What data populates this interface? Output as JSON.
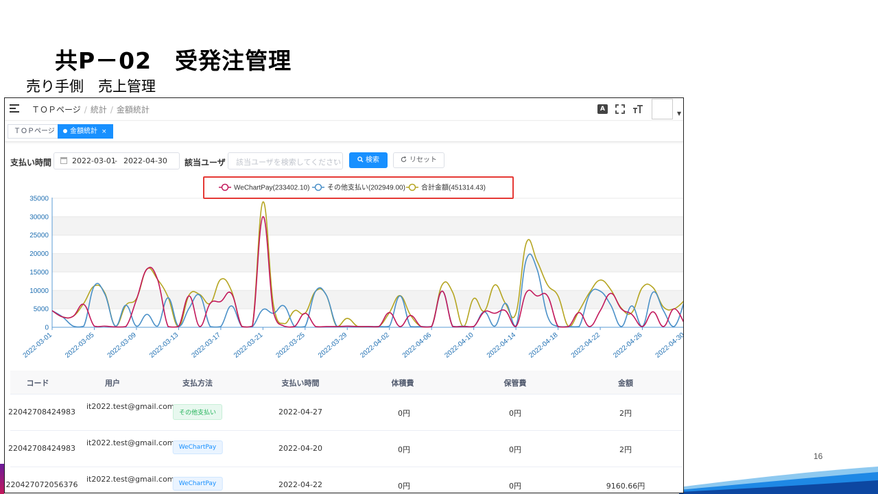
{
  "slide": {
    "title": "共P－02　受発注管理",
    "subtitle": "売り手側　売上管理",
    "page_number": "16"
  },
  "navbar": {
    "breadcrumb": [
      "ＴＯＰページ",
      "統計",
      "金額統計"
    ],
    "icons": [
      "translate-icon",
      "fullscreen-icon",
      "font-size-icon"
    ],
    "translate_glyph": "A"
  },
  "tags": [
    {
      "label": "ＴＯＰページ",
      "active": false
    },
    {
      "label": "金額統計",
      "active": true,
      "close": "×"
    }
  ],
  "filter": {
    "payment_time_label": "支払い時間",
    "date_start": "2022-03-01",
    "date_sep": "-",
    "date_end": "2022-04-30",
    "user_label": "該当ユーザ",
    "user_placeholder": "該当ユーザを検索してください",
    "search_button": "検索",
    "reset_button": "リセット"
  },
  "colors": {
    "wechat": "#c2185b",
    "other": "#4a90c8",
    "total": "#b5a521",
    "primary": "#1890ff",
    "highlight_box": "#e53935"
  },
  "chart_data": {
    "type": "line",
    "legend": [
      {
        "name": "WeChartPay(233402.10)",
        "key": "wechat"
      },
      {
        "name": "その他支払い(202949.00)",
        "key": "other"
      },
      {
        "name": "合計金額(451314.43)",
        "key": "total"
      }
    ],
    "legend_position": "top-center",
    "ylim": [
      0,
      35000
    ],
    "yticks": [
      "0",
      "5000",
      "10000",
      "15000",
      "20000",
      "25000",
      "30000",
      "35000"
    ],
    "grid": "horizontal bands",
    "x": [
      "2022-03-01",
      "2022-03-02",
      "2022-03-03",
      "2022-03-04",
      "2022-03-05",
      "2022-03-06",
      "2022-03-07",
      "2022-03-08",
      "2022-03-09",
      "2022-03-10",
      "2022-03-11",
      "2022-03-12",
      "2022-03-13",
      "2022-03-14",
      "2022-03-15",
      "2022-03-16",
      "2022-03-17",
      "2022-03-18",
      "2022-03-19",
      "2022-03-20",
      "2022-03-21",
      "2022-03-22",
      "2022-03-23",
      "2022-03-24",
      "2022-03-25",
      "2022-03-26",
      "2022-03-27",
      "2022-03-28",
      "2022-03-29",
      "2022-03-30",
      "2022-03-31",
      "2022-04-01",
      "2022-04-02",
      "2022-04-03",
      "2022-04-04",
      "2022-04-05",
      "2022-04-06",
      "2022-04-07",
      "2022-04-08",
      "2022-04-09",
      "2022-04-10",
      "2022-04-11",
      "2022-04-12",
      "2022-04-13",
      "2022-04-14",
      "2022-04-15",
      "2022-04-16",
      "2022-04-17",
      "2022-04-18",
      "2022-04-19",
      "2022-04-20",
      "2022-04-21",
      "2022-04-22",
      "2022-04-23",
      "2022-04-24",
      "2022-04-25",
      "2022-04-26",
      "2022-04-27",
      "2022-04-28",
      "2022-04-29",
      "2022-04-30"
    ],
    "xtick_labels": [
      "2022-03-01",
      "2022-03-05",
      "2022-03-09",
      "2022-03-13",
      "2022-03-17",
      "2022-03-21",
      "2022-03-25",
      "2022-03-29",
      "2022-04-02",
      "2022-04-06",
      "2022-04-10",
      "2022-04-14",
      "2022-04-18",
      "2022-04-22",
      "2022-04-26",
      "2022-04-30"
    ],
    "series": [
      {
        "key": "wechat",
        "values": [
          4500,
          2800,
          3000,
          6200,
          300,
          300,
          100,
          200,
          7500,
          15800,
          13000,
          200,
          200,
          8500,
          200,
          6500,
          7000,
          9200,
          200,
          300,
          30000,
          4000,
          300,
          200,
          3800,
          200,
          200,
          200,
          300,
          200,
          200,
          200,
          4000,
          200,
          3200,
          200,
          200,
          9800,
          200,
          200,
          200,
          4200,
          3800,
          4500,
          200,
          9500,
          8500,
          8500,
          200,
          200,
          4000,
          200,
          4500,
          9200,
          5000,
          3500,
          200,
          4200,
          200,
          5000,
          1000
        ]
      },
      {
        "key": "other",
        "values": [
          4500,
          2800,
          300,
          300,
          11200,
          9000,
          300,
          6000,
          300,
          3500,
          300,
          8000,
          300,
          5200,
          8700,
          200,
          200,
          5800,
          200,
          200,
          4800,
          3800,
          5800,
          200,
          200,
          9800,
          8800,
          300,
          300,
          200,
          200,
          200,
          300,
          8500,
          200,
          200,
          200,
          9800,
          300,
          300,
          200,
          4200,
          300,
          6500,
          300,
          18500,
          15800,
          3000,
          200,
          200,
          200,
          9000,
          9800,
          6000,
          200,
          5800,
          200,
          9500,
          4500,
          200,
          7200
        ]
      },
      {
        "key": "total",
        "values": [
          4500,
          2800,
          3000,
          6500,
          11200,
          9300,
          300,
          6000,
          7800,
          15800,
          13000,
          8200,
          200,
          8800,
          8900,
          6500,
          13000,
          10000,
          200,
          300,
          34000,
          6000,
          1000,
          4500,
          3800,
          9800,
          8800,
          200,
          2400,
          200,
          200,
          200,
          4000,
          8600,
          3300,
          200,
          200,
          11500,
          9500,
          200,
          7800,
          4400,
          11500,
          6500,
          3800,
          23000,
          18000,
          11500,
          8500,
          200,
          4500,
          9500,
          12800,
          10200,
          5200,
          4000,
          10800,
          10800,
          5500,
          5000,
          7300
        ]
      }
    ]
  },
  "table": {
    "headers": [
      "コード",
      "用户",
      "支払方法",
      "支払い時間",
      "体積費",
      "保管費",
      "金額"
    ],
    "rows": [
      {
        "code": "22042708424983",
        "user": "it2022.test@gmail.com",
        "method": "その他支払い",
        "method_type": "other",
        "time": "2022-04-27",
        "volume_fee": "0円",
        "storage_fee": "0円",
        "amount": "2円"
      },
      {
        "code": "22042708424983",
        "user": "it2022.test@gmail.com",
        "method": "WeChartPay",
        "method_type": "wechat",
        "time": "2022-04-20",
        "volume_fee": "0円",
        "storage_fee": "0円",
        "amount": "2円"
      },
      {
        "code": "220427072056376",
        "user": "it2022.test@gmail.com",
        "method": "WeChartPay",
        "method_type": "wechat",
        "time": "2022-04-22",
        "volume_fee": "0円",
        "storage_fee": "0円",
        "amount": "9160.66円"
      }
    ]
  }
}
